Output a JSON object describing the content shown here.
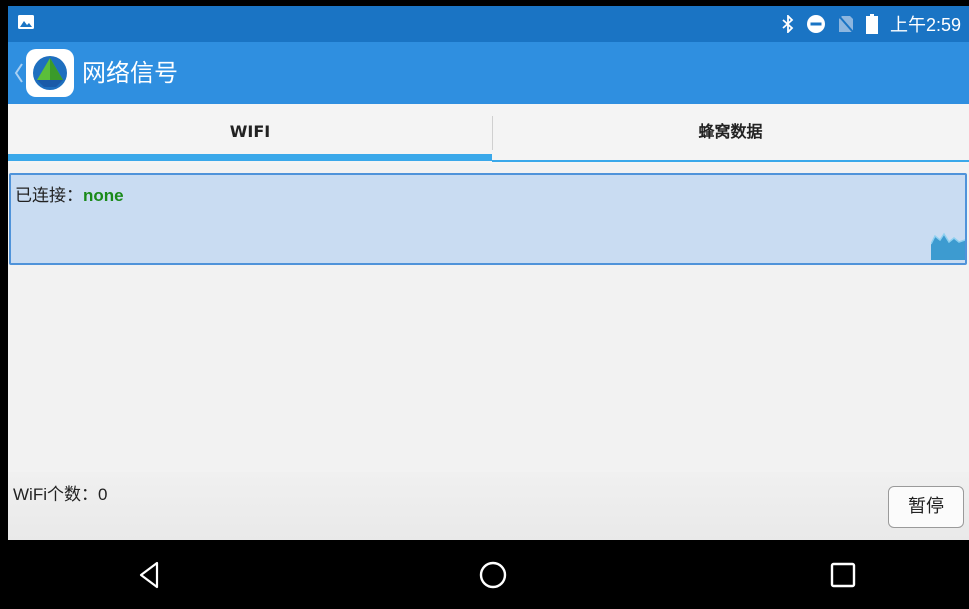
{
  "status_bar": {
    "time": "上午2:59",
    "icons": [
      "image-icon",
      "bluetooth-icon",
      "do-not-disturb-icon",
      "no-sim-icon",
      "battery-icon"
    ]
  },
  "action_bar": {
    "title": "网络信号",
    "logo_icon": "app-logo-icon",
    "back_icon": "chevron-left-icon"
  },
  "tabs": [
    {
      "label": "WIFI",
      "selected": true
    },
    {
      "label": "蜂窝数据",
      "selected": false
    }
  ],
  "connected": {
    "label": "已连接：",
    "value": "none"
  },
  "footer": {
    "wifi_count_label": "WiFi个数：",
    "wifi_count": "0",
    "pause_label": "暂停"
  },
  "nav": {
    "icons": [
      "back-icon",
      "home-icon",
      "recent-apps-icon"
    ]
  },
  "colors": {
    "status_bar": "#1a74c4",
    "action_bar": "#2f8fe0",
    "tab_indicator": "#3aa8ea",
    "connected_bg": "#c9dcf2",
    "connected_value": "#1a8a1a"
  }
}
